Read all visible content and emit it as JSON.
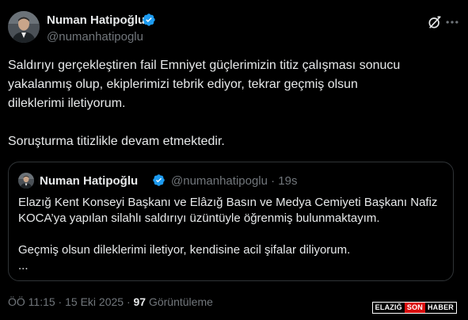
{
  "author": {
    "name": "Numan Hatipoğlu",
    "handle": "@numanhatipoglu"
  },
  "tweet": {
    "text": "Saldırıyı gerçekleştiren fail Emniyet güçlerimizin titiz çalışması sonucu\nyakalanmış olup, ekiplerimizi tebrik ediyor, tekrar geçmiş olsun\ndileklerimi iletiyorum.\n\nSoruşturma titizlikle devam etmektedir."
  },
  "quoted": {
    "name": "Numan Hatipoğlu",
    "meta": "@numanhatipoglu · 19s",
    "text": "Elazığ Kent Konseyi Başkanı ve Elâzığ Basın ve Medya Cemiyeti Başkanı Nafiz\nKOCA’ya yapılan silahlı saldırıyı üzüntüyle öğrenmiş bulunmaktayım.\n\nGeçmiş olsun dileklerimi iletiyor, kendisine acil şifalar diliyorum.\n..."
  },
  "footer": {
    "time": "ÖÖ 11:15 · 15 Eki 2025 · ",
    "views": "97",
    "views_label": " Görüntüleme"
  },
  "watermark": {
    "part1": "ELAZIĞ",
    "part2": "SON",
    "part3": "HABER"
  },
  "icons": {
    "verified": "verified-badge-icon",
    "grok": "grok-icon",
    "more": "more-options-icon"
  },
  "colors": {
    "background": "#000000",
    "text": "#e7e9ea",
    "secondary": "#71767b",
    "verified": "#1d9bf0",
    "border": "#2f3336",
    "watermark_red": "#d90f0f"
  }
}
